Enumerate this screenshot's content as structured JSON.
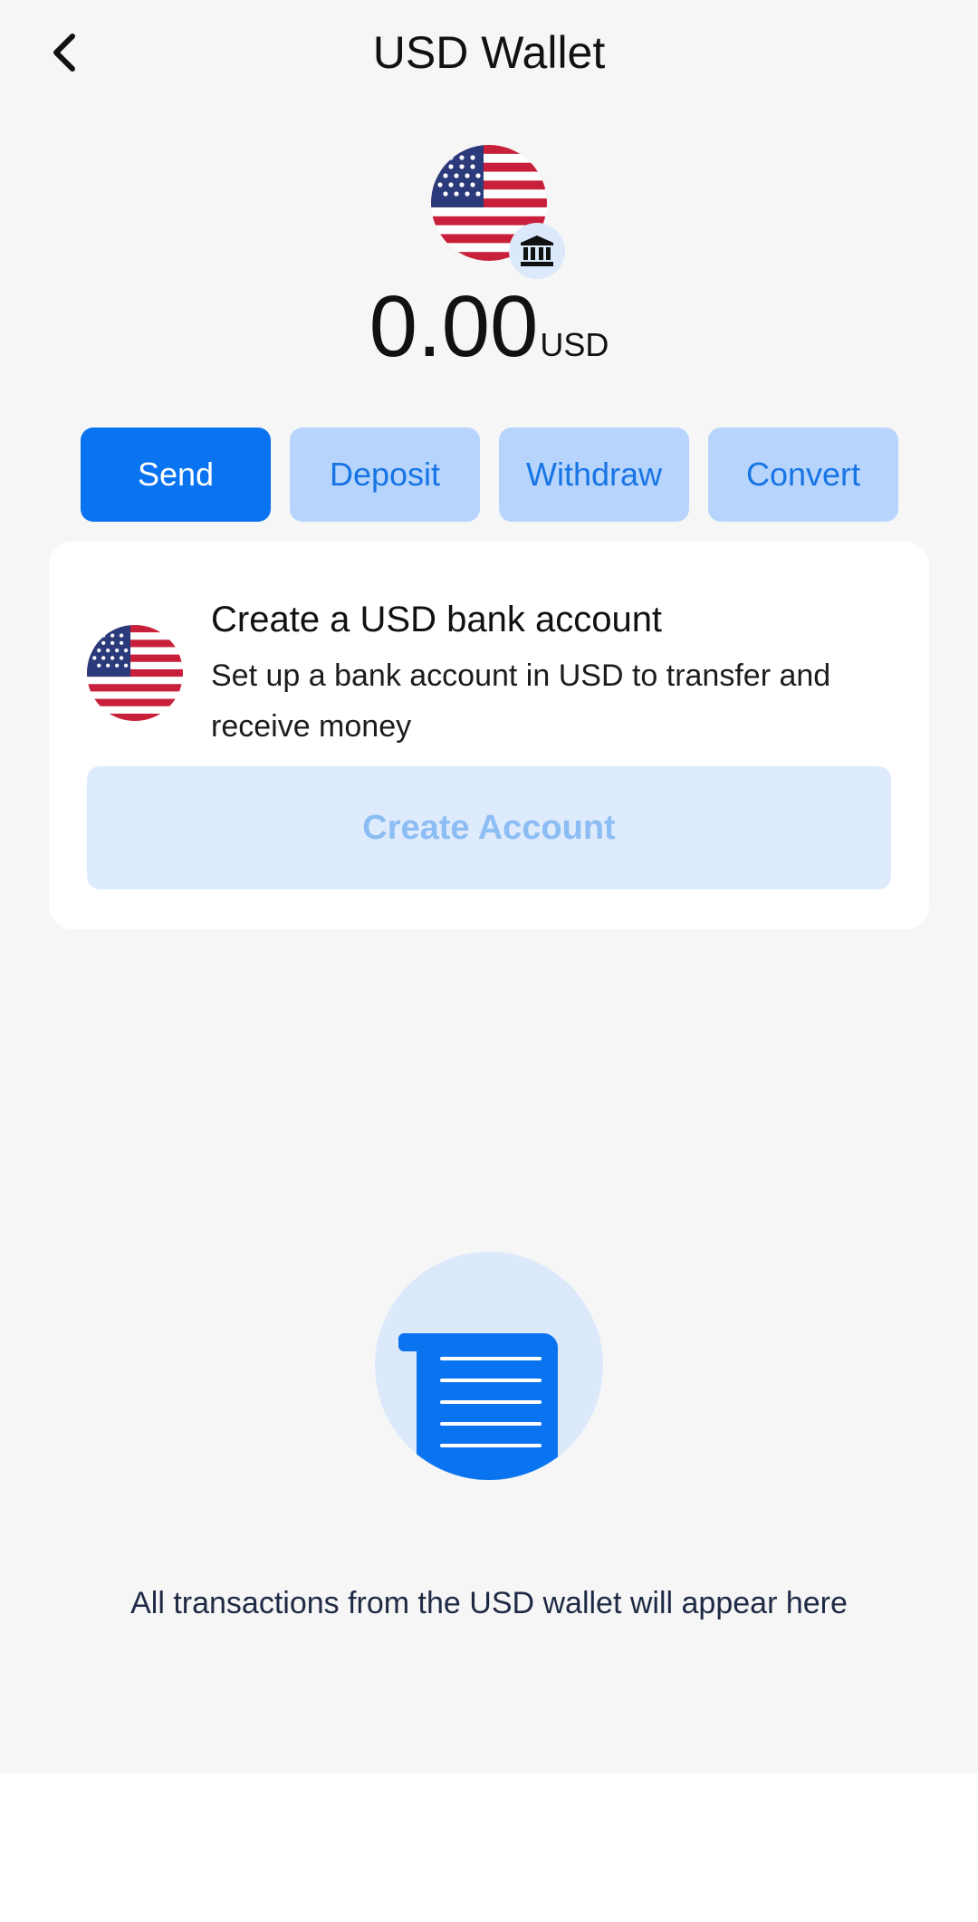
{
  "header": {
    "title": "USD Wallet",
    "back_icon": "chevron-left-icon"
  },
  "wallet": {
    "flag_icon": "us-flag-icon",
    "badge_icon": "bank-icon",
    "balance": "0.00",
    "currency": "USD"
  },
  "actions": [
    {
      "label": "Send",
      "primary": true
    },
    {
      "label": "Deposit",
      "primary": false
    },
    {
      "label": "Withdraw",
      "primary": false
    },
    {
      "label": "Convert",
      "primary": false
    }
  ],
  "bank_card": {
    "flag_icon": "us-flag-icon",
    "title": "Create a USD bank account",
    "description": "Set up a bank account in USD to transfer and receive money",
    "button_label": "Create Account"
  },
  "transactions": {
    "empty_icon": "receipt-icon",
    "empty_message": "All transactions from the USD wallet will appear here"
  },
  "colors": {
    "primary": "#0a74f0",
    "secondary_button_bg": "#b7d5fc",
    "secondary_button_text": "#1774e5",
    "disabled_button_bg": "#deebfc",
    "disabled_button_text": "#8cbdf4",
    "background": "#f6f6f7"
  }
}
